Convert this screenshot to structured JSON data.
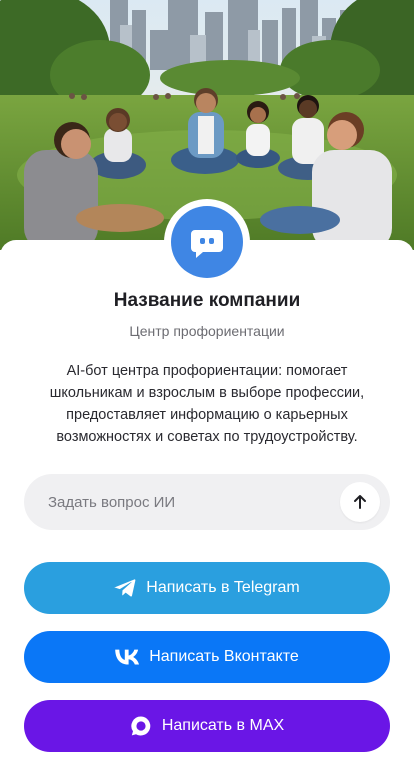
{
  "company": {
    "name": "Название компании",
    "subtitle": "Центр профориентации",
    "description": "AI-бот центра профориентации: помогает школьникам и взрослым в выборе профессии, предоставляет информацию о карьерных возможностях и советах по трудоустройству."
  },
  "ask": {
    "placeholder": "Задать вопрос ИИ",
    "value": ""
  },
  "actions": {
    "telegram_label": "Написать в Telegram",
    "vk_label": "Написать Вконтакте",
    "max_label": "Написать в MAX"
  },
  "icons": {
    "avatar": "chat-bot-icon",
    "send": "arrow-up-icon",
    "telegram": "telegram-icon",
    "vk": "vk-icon",
    "max": "max-chat-icon"
  },
  "colors": {
    "avatar": "#3f86e4",
    "telegram": "#2a9fdf",
    "vk": "#0a77f7",
    "max": "#6a16e6",
    "input_bg": "#f0f0f2"
  }
}
